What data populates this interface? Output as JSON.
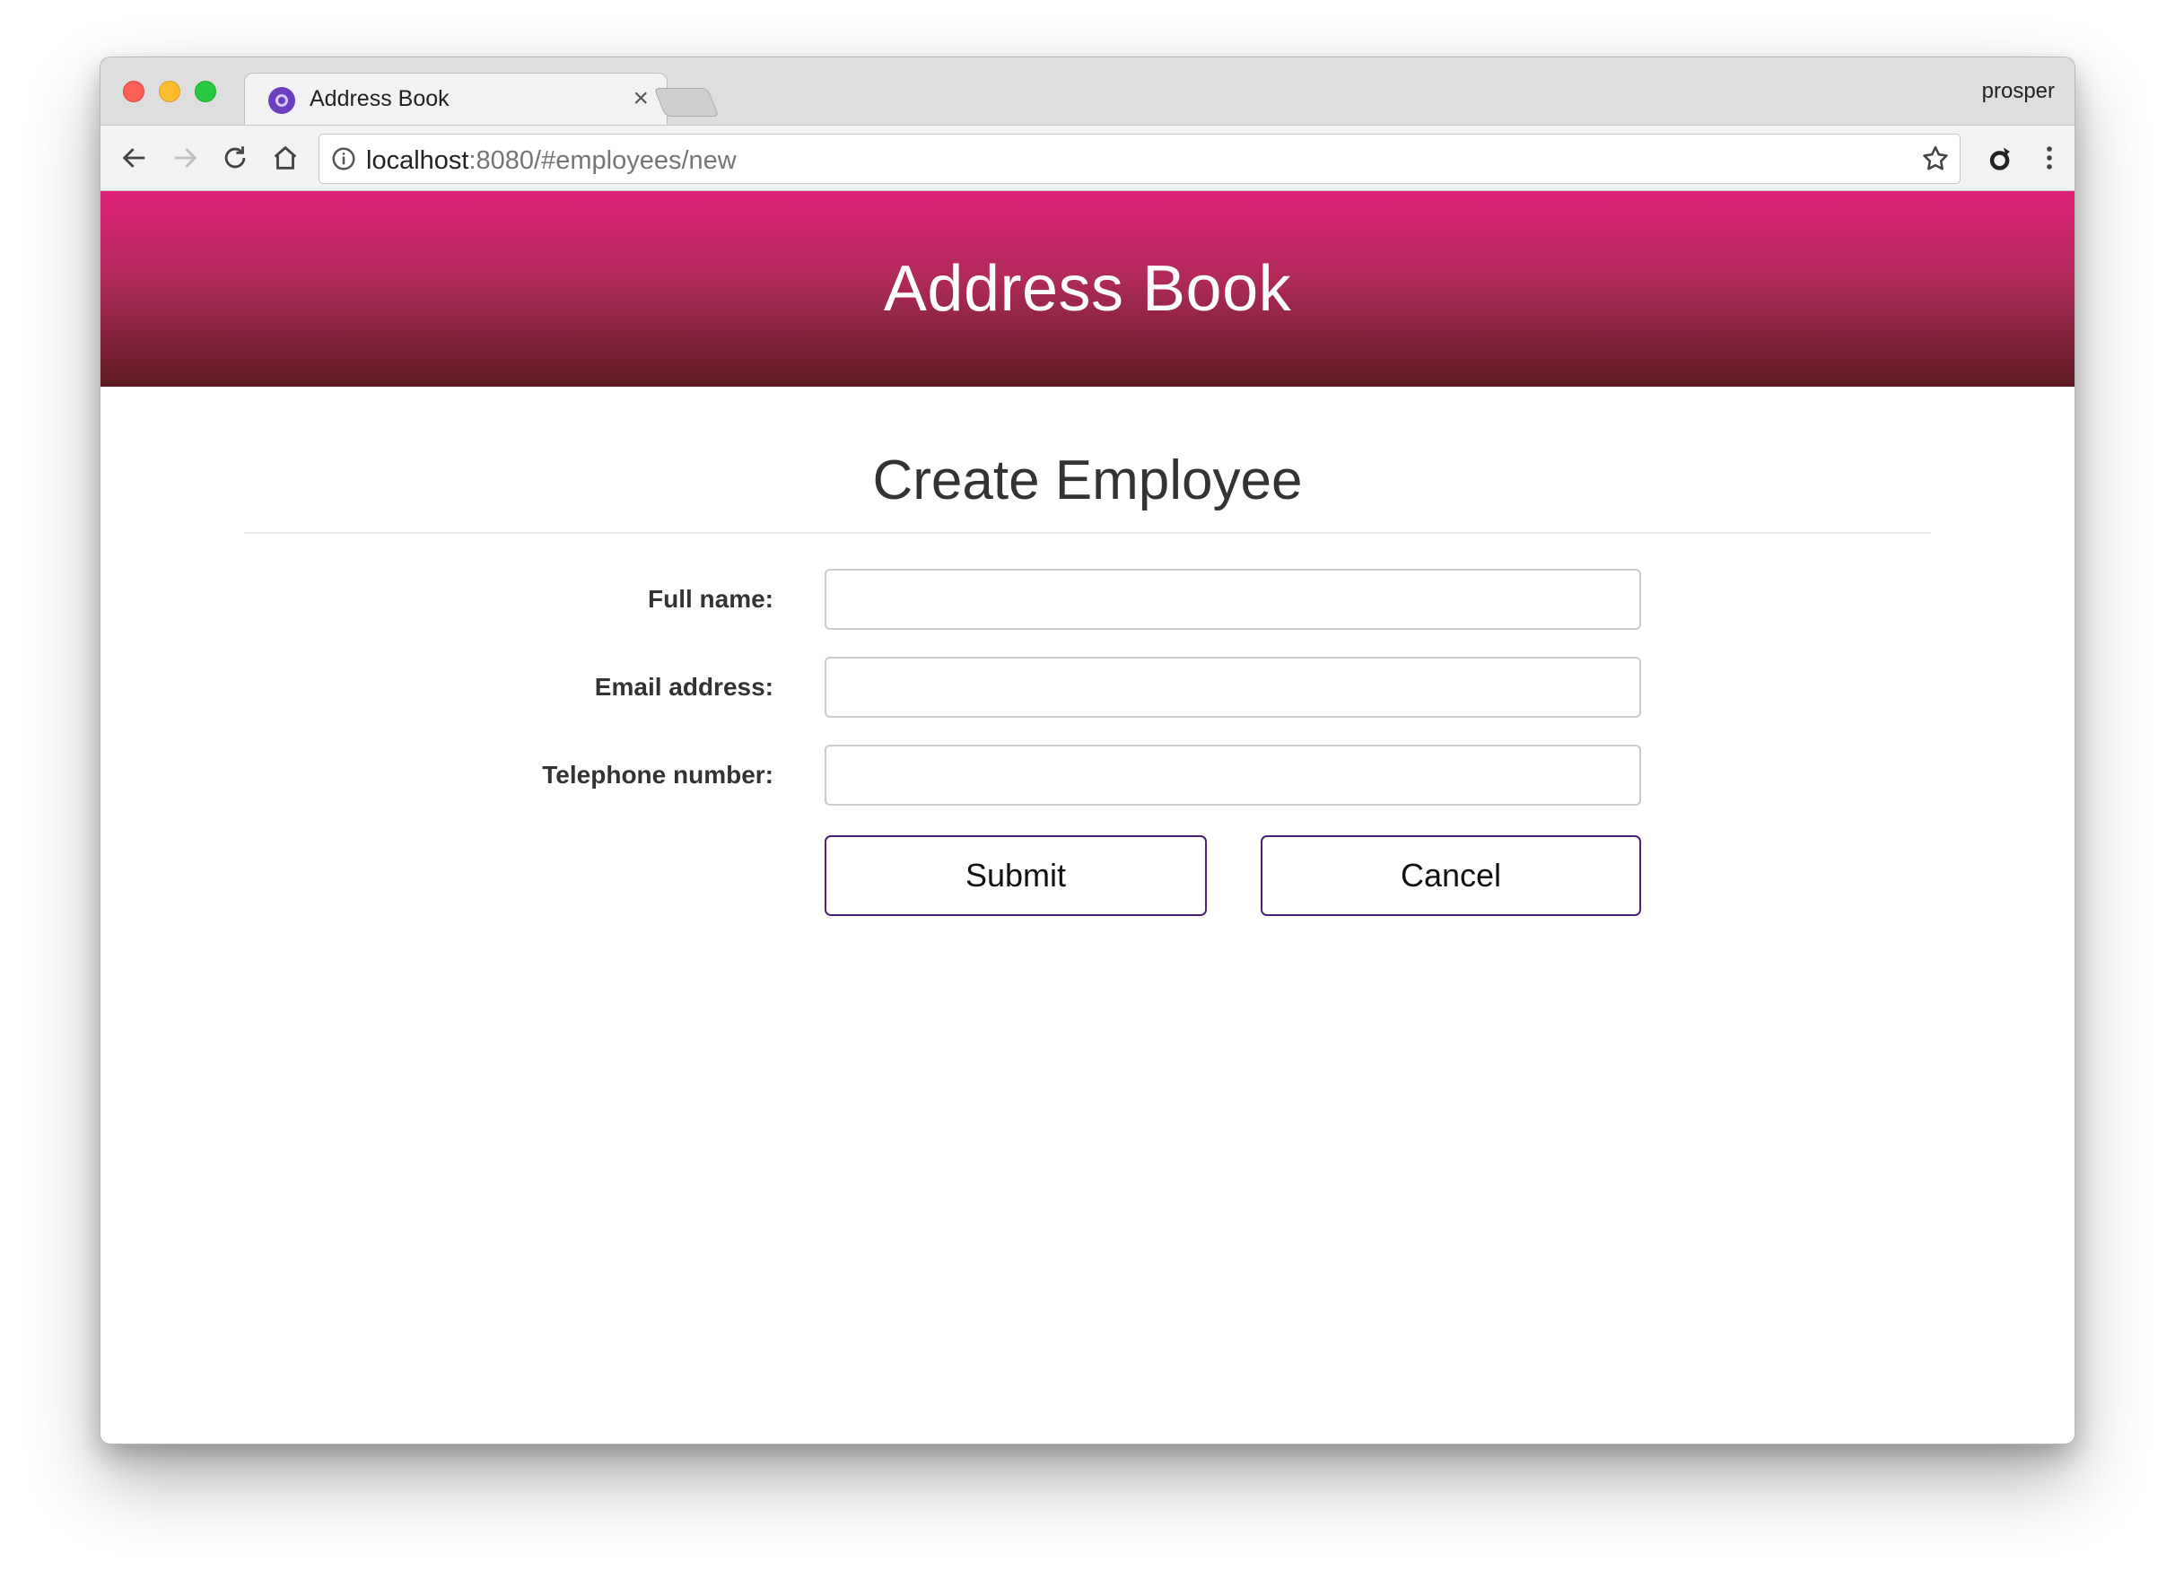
{
  "browser": {
    "tab": {
      "title": "Address Book",
      "close_glyph": "×",
      "favicon": "purple-app-icon"
    },
    "profile_name": "prosper",
    "url": {
      "host": "localhost",
      "rest": ":8080/#employees/new"
    },
    "icons": [
      "back-icon",
      "forward-icon",
      "reload-icon",
      "home-icon",
      "info-icon",
      "star-icon",
      "extension-icon",
      "menu-dots-icon"
    ]
  },
  "app": {
    "title": "Address Book",
    "brand_colors": {
      "banner_top": "#e0227b",
      "banner_bottom": "#5e1c22",
      "button_border": "#4a2273"
    }
  },
  "form": {
    "heading": "Create Employee",
    "fields": {
      "full_name": {
        "label": "Full name:",
        "value": ""
      },
      "email": {
        "label": "Email address:",
        "value": ""
      },
      "telephone": {
        "label": "Telephone number:",
        "value": ""
      }
    },
    "submit_label": "Submit",
    "cancel_label": "Cancel"
  }
}
